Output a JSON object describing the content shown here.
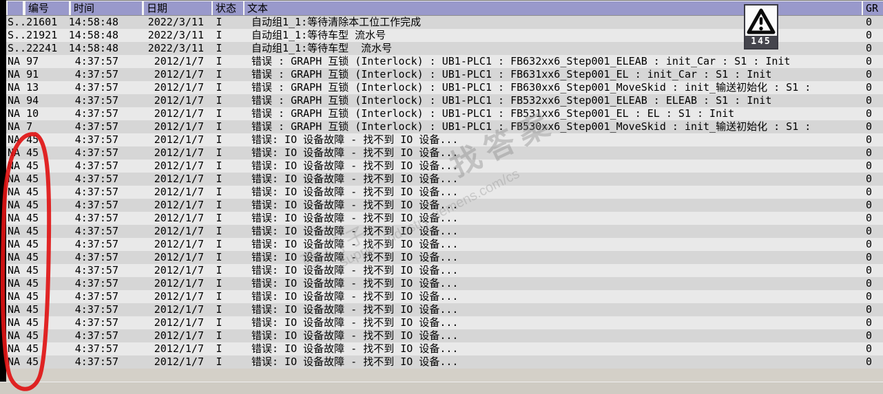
{
  "alarm_table": {
    "columns": {
      "row_selector": "",
      "number": "编号",
      "time": "时间",
      "date": "日期",
      "state": "状态",
      "text": "文本",
      "group": "GR"
    },
    "rows": [
      {
        "id": "S..21601",
        "time": "14:58:48",
        "date": "2022/3/11",
        "state": "I",
        "text": "自动组1_1:等待清除本工位工作完成",
        "gr": "0"
      },
      {
        "id": "S..21921",
        "time": "14:58:48",
        "date": "2022/3/11",
        "state": "I",
        "text": "自动组1_1:等待车型 流水号",
        "gr": "0"
      },
      {
        "id": "S..22241",
        "time": "14:58:48",
        "date": "2022/3/11",
        "state": "I",
        "text": "自动组1_1:等待车型  流水号",
        "gr": "0"
      },
      {
        "id": "NA 97",
        "time": "4:37:57",
        "date": "2012/1/7",
        "state": "I",
        "text": "错误 : GRAPH 互锁 (Interlock) : UB1-PLC1 : FB632xx6_Step001_ELEAB : init_Car : S1 : Init",
        "gr": "0"
      },
      {
        "id": "NA 91",
        "time": "4:37:57",
        "date": "2012/1/7",
        "state": "I",
        "text": "错误 : GRAPH 互锁 (Interlock) : UB1-PLC1 : FB631xx6_Step001_EL : init_Car : S1 : Init",
        "gr": "0"
      },
      {
        "id": "NA 13",
        "time": "4:37:57",
        "date": "2012/1/7",
        "state": "I",
        "text": "错误 : GRAPH 互锁 (Interlock) : UB1-PLC1 : FB630xx6_Step001_MoveSkid : init_输送初始化 : S1 :",
        "gr": "0"
      },
      {
        "id": "NA 94",
        "time": "4:37:57",
        "date": "2012/1/7",
        "state": "I",
        "text": "错误 : GRAPH 互锁 (Interlock) : UB1-PLC1 : FB532xx6_Step001_ELEAB : ELEAB : S1 : Init",
        "gr": "0"
      },
      {
        "id": "NA 10",
        "time": "4:37:57",
        "date": "2012/1/7",
        "state": "I",
        "text": "错误 : GRAPH 互锁 (Interlock) : UB1-PLC1 : FB531xx6_Step001_EL : EL : S1 : Init",
        "gr": "0"
      },
      {
        "id": "NA 7",
        "time": "4:37:57",
        "date": "2012/1/7",
        "state": "I",
        "text": "错误 : GRAPH 互锁 (Interlock) : UB1-PLC1 : FB530xx6_Step001_MoveSkid : init_输送初始化 : S1 :",
        "gr": "0"
      },
      {
        "id": "NA 45",
        "time": "4:37:57",
        "date": "2012/1/7",
        "state": "I",
        "text": "错误: IO 设备故障 - 找不到 IO 设备...",
        "gr": "0"
      },
      {
        "id": "NA 45",
        "time": "4:37:57",
        "date": "2012/1/7",
        "state": "I",
        "text": "错误: IO 设备故障 - 找不到 IO 设备...",
        "gr": "0"
      },
      {
        "id": "NA 45",
        "time": "4:37:57",
        "date": "2012/1/7",
        "state": "I",
        "text": "错误: IO 设备故障 - 找不到 IO 设备...",
        "gr": "0"
      },
      {
        "id": "NA 45",
        "time": "4:37:57",
        "date": "2012/1/7",
        "state": "I",
        "text": "错误: IO 设备故障 - 找不到 IO 设备...",
        "gr": "0"
      },
      {
        "id": "NA 45",
        "time": "4:37:57",
        "date": "2012/1/7",
        "state": "I",
        "text": "错误: IO 设备故障 - 找不到 IO 设备...",
        "gr": "0"
      },
      {
        "id": "NA 45",
        "time": "4:37:57",
        "date": "2012/1/7",
        "state": "I",
        "text": "错误: IO 设备故障 - 找不到 IO 设备...",
        "gr": "0"
      },
      {
        "id": "NA 45",
        "time": "4:37:57",
        "date": "2012/1/7",
        "state": "I",
        "text": "错误: IO 设备故障 - 找不到 IO 设备...",
        "gr": "0"
      },
      {
        "id": "NA 45",
        "time": "4:37:57",
        "date": "2012/1/7",
        "state": "I",
        "text": "错误: IO 设备故障 - 找不到 IO 设备...",
        "gr": "0"
      },
      {
        "id": "NA 45",
        "time": "4:37:57",
        "date": "2012/1/7",
        "state": "I",
        "text": "错误: IO 设备故障 - 找不到 IO 设备...",
        "gr": "0"
      },
      {
        "id": "NA 45",
        "time": "4:37:57",
        "date": "2012/1/7",
        "state": "I",
        "text": "错误: IO 设备故障 - 找不到 IO 设备...",
        "gr": "0"
      },
      {
        "id": "NA 45",
        "time": "4:37:57",
        "date": "2012/1/7",
        "state": "I",
        "text": "错误: IO 设备故障 - 找不到 IO 设备...",
        "gr": "0"
      },
      {
        "id": "NA 45",
        "time": "4:37:57",
        "date": "2012/1/7",
        "state": "I",
        "text": "错误: IO 设备故障 - 找不到 IO 设备...",
        "gr": "0"
      },
      {
        "id": "NA 45",
        "time": "4:37:57",
        "date": "2012/1/7",
        "state": "I",
        "text": "错误: IO 设备故障 - 找不到 IO 设备...",
        "gr": "0"
      },
      {
        "id": "NA 45",
        "time": "4:37:57",
        "date": "2012/1/7",
        "state": "I",
        "text": "错误: IO 设备故障 - 找不到 IO 设备...",
        "gr": "0"
      },
      {
        "id": "NA 45",
        "time": "4:37:57",
        "date": "2012/1/7",
        "state": "I",
        "text": "错误: IO 设备故障 - 找不到 IO 设备...",
        "gr": "0"
      },
      {
        "id": "NA 45",
        "time": "4:37:57",
        "date": "2012/1/7",
        "state": "I",
        "text": "错误: IO 设备故障 - 找不到 IO 设备...",
        "gr": "0"
      },
      {
        "id": "NA 45",
        "time": "4:37:57",
        "date": "2012/1/7",
        "state": "I",
        "text": "错误: IO 设备故障 - 找不到 IO 设备...",
        "gr": "0"
      },
      {
        "id": "NA 45",
        "time": "4:37:57",
        "date": "2012/1/7",
        "state": "I",
        "text": "错误: IO 设备故障 - 找不到 IO 设备...",
        "gr": "0"
      }
    ]
  },
  "warning_badge": {
    "count": "145"
  },
  "watermark": {
    "text_cn": "找答案",
    "brand_cn": "西门子",
    "url": "support.industry.siemens.com/cs"
  },
  "colors": {
    "header-bg": "#9999CB",
    "row-dark": "#D6D6D6",
    "row-light": "#E9E9E9",
    "bottom-bar": "#CFCBC3",
    "badge-bar": "#45454D",
    "badge-border": "#3A3A42",
    "annotation-red": "#E01313"
  }
}
